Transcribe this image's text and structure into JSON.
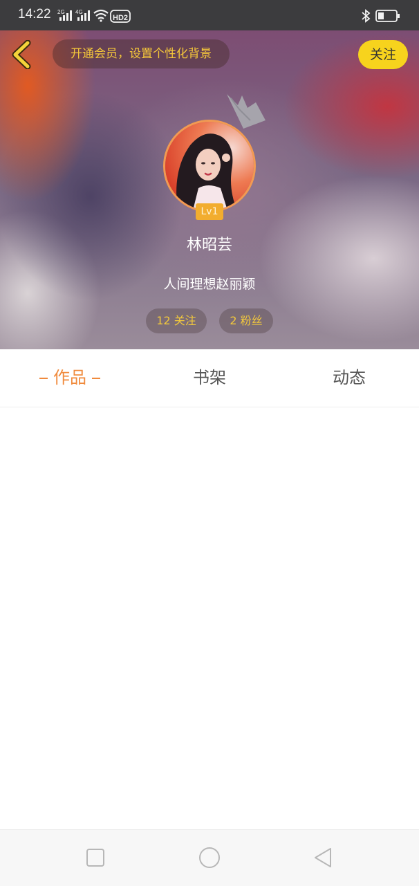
{
  "status_bar": {
    "time": "14:22",
    "network_1": "2G",
    "network_2": "4G",
    "hd_label": "HD2",
    "icons": [
      "signal-icon",
      "signal-icon",
      "wifi-icon",
      "hd-icon",
      "bluetooth-icon",
      "battery-icon"
    ]
  },
  "header": {
    "vip_banner": "开通会员，设置个性化背景",
    "follow_label": "关注",
    "level": "Lv1",
    "name": "林昭芸",
    "signature": "人间理想赵丽颖",
    "following": "12 关注",
    "fans": "2 粉丝"
  },
  "tabs": [
    {
      "label": "作品",
      "active": true
    },
    {
      "label": "书架",
      "active": false
    },
    {
      "label": "动态",
      "active": false
    }
  ],
  "nav_bar": {
    "buttons": [
      "recent-apps",
      "home",
      "back"
    ]
  },
  "colors": {
    "accent": "#f08a3c",
    "follow_button": "#f7d31d",
    "stat_text": "#f3c93c"
  }
}
